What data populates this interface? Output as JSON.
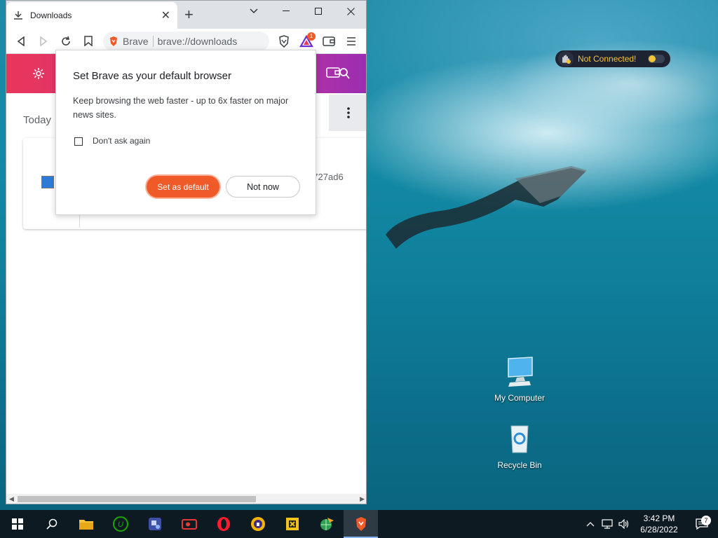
{
  "browser": {
    "tab_title": "Downloads",
    "tab_close": "✕",
    "new_tab": "+",
    "omnibox": {
      "shield_label": "Brave",
      "url": "brave://downloads"
    },
    "rewards_badge": "1"
  },
  "downloads_page": {
    "section_today": "Today",
    "partial_hash": "fb52727ad6"
  },
  "popup": {
    "title": "Set Brave as your default browser",
    "body": "Keep browsing the web faster - up to 6x faster on major news sites.",
    "checkbox_label": "Don't ask again",
    "set_default_label": "Set as default",
    "not_now_label": "Not now"
  },
  "vpn": {
    "status": "Not Connected!"
  },
  "desktop_icons": [
    {
      "label": "My Computer"
    },
    {
      "label": "Recycle Bin"
    }
  ],
  "taskbar": {
    "time": "3:42 PM",
    "date": "6/28/2022",
    "notification_count": "7",
    "apps": [
      "start",
      "search",
      "file-explorer",
      "upwork",
      "app-tool",
      "screen-recorder",
      "opera",
      "privacy-app",
      "puzzle-app",
      "network-app",
      "brave"
    ]
  },
  "colors": {
    "brave_orange": "#f05a28",
    "header_gradient_start": "#e8365b",
    "header_gradient_end": "#9b2db0",
    "vpn_text": "#f3c43a"
  }
}
